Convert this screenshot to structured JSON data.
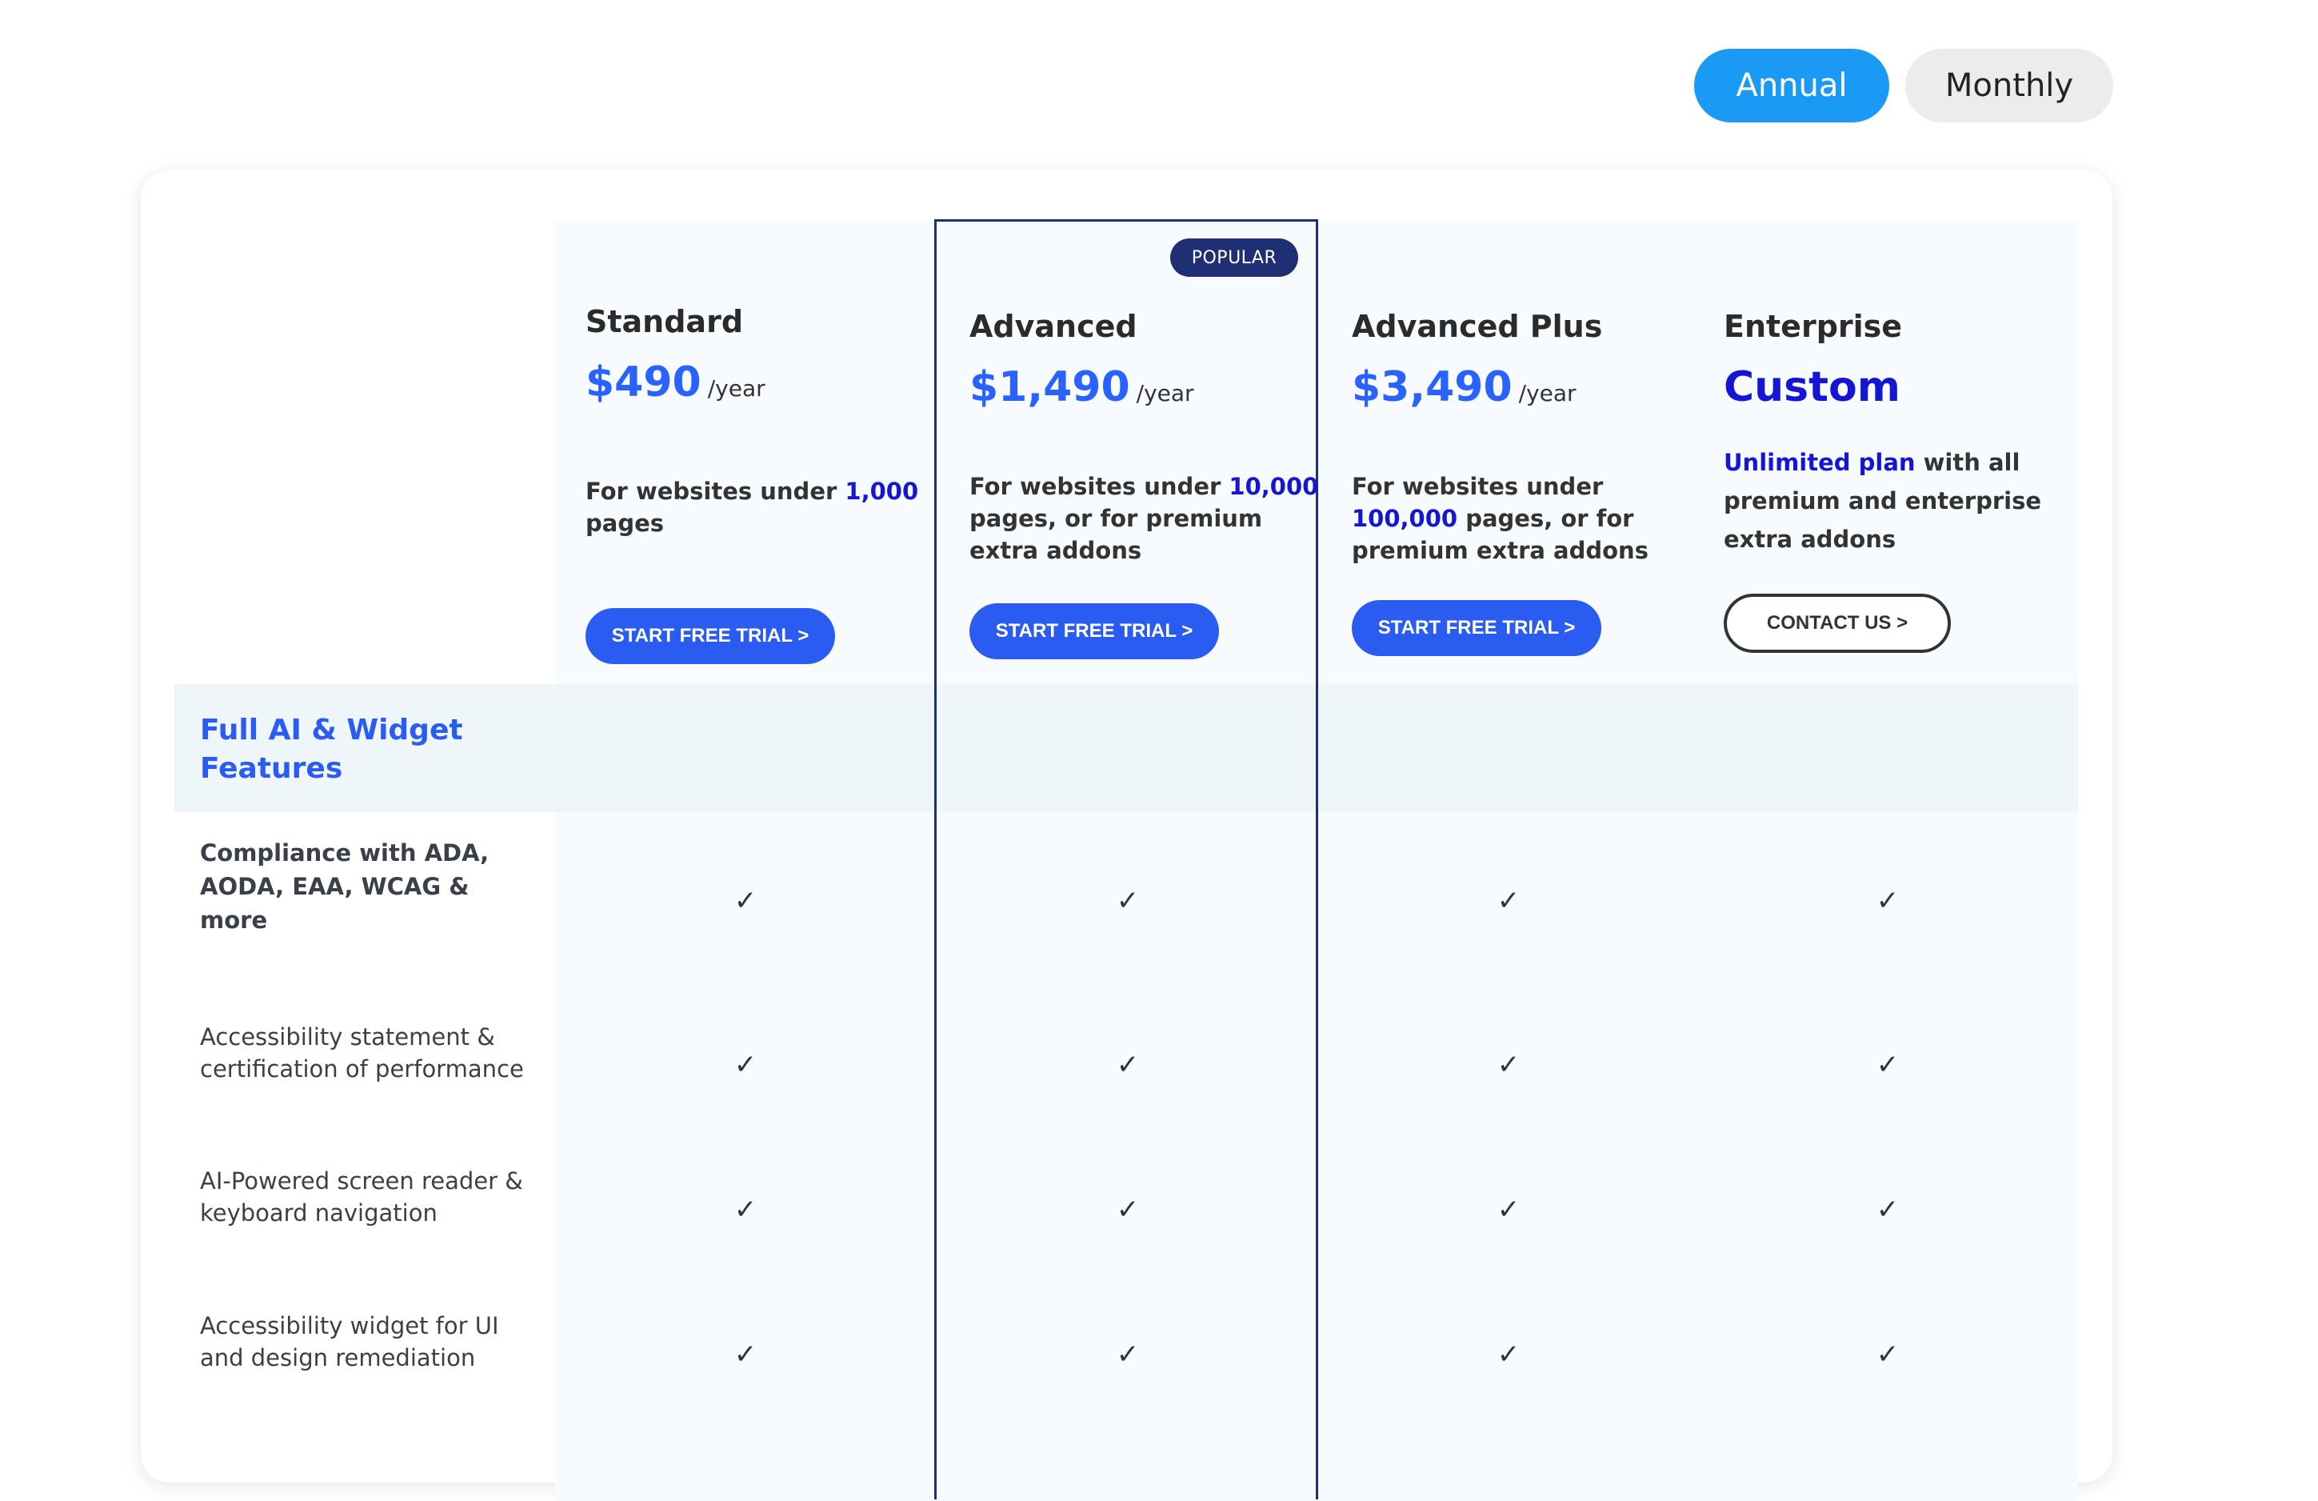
{
  "toggle": {
    "annual_label": "Annual",
    "monthly_label": "Monthly"
  },
  "popular_badge": "POPULAR",
  "plans": [
    {
      "name": "Standard",
      "price": "$490",
      "period": "/year",
      "desc_prefix": "For websites under ",
      "desc_highlight": "1,000",
      "desc_suffix": " pages",
      "cta": "START FREE TRIAL >"
    },
    {
      "name": "Advanced",
      "price": "$1,490",
      "period": "/year",
      "desc_prefix": "For websites under ",
      "desc_highlight": "10,000",
      "desc_suffix": " pages, or for premium extra addons",
      "cta": "START FREE TRIAL >"
    },
    {
      "name": "Advanced Plus",
      "price": "$3,490",
      "period": "/year",
      "desc_prefix": "For websites under ",
      "desc_highlight": "100,000",
      "desc_suffix": " pages, or for premium extra addons",
      "cta": "START FREE TRIAL >"
    },
    {
      "name": "Enterprise",
      "price": "Custom",
      "desc_highlight": "Unlimited plan",
      "desc_suffix": " with all premium and enterprise extra addons",
      "cta": "CONTACT US >"
    }
  ],
  "section_title": "Full AI & Widget Features",
  "features": [
    "Compliance with ADA, AODA, EAA, WCAG & more",
    "Accessibility statement & certification of performance",
    "AI-Powered screen reader & keyboard navigation",
    "Accessibility widget for UI and design remediation"
  ],
  "check_glyph": "✓"
}
